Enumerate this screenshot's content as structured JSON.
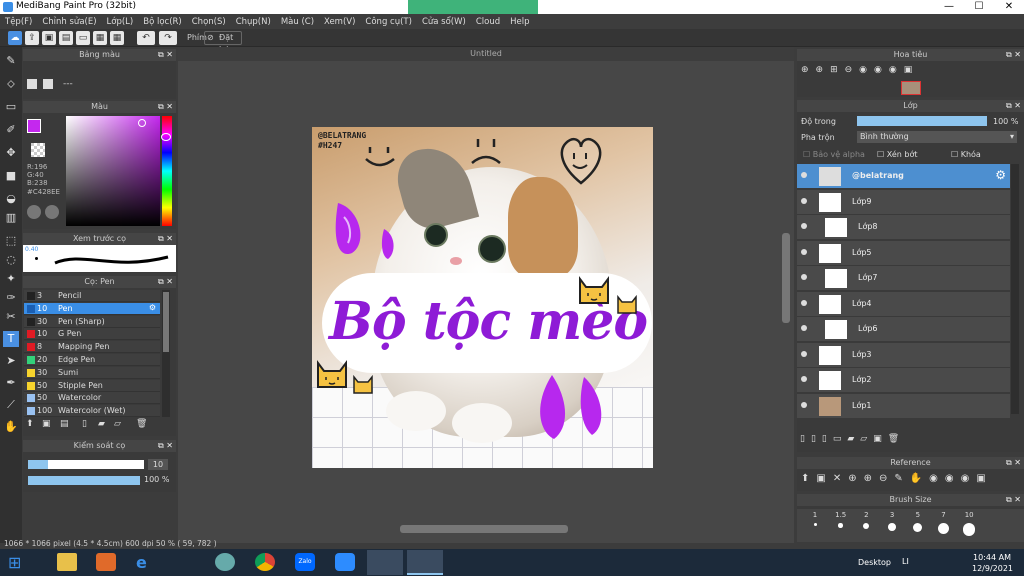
{
  "app": {
    "title": "MediBang Paint Pro (32bit)"
  },
  "menu": [
    "Tệp(F)",
    "Chỉnh sửa(E)",
    "Lớp(L)",
    "Bộ lọc(R)",
    "Chọn(S)",
    "Chụp(N)",
    "Màu (C)",
    "Xem(V)",
    "Công cụ(T)",
    "Cửa sổ(W)",
    "Cloud",
    "Help"
  ],
  "toolbar": {
    "shortcut_label": "Phím",
    "reset_label": "Đặt lại"
  },
  "canvas": {
    "tab_title": "Untitled",
    "status": "1066 * 1066 pixel  (4.5 * 4.5cm)  600 dpi  50 %  ( 59, 782 )"
  },
  "artwork": {
    "watermark": "@BELATRANG\n#H247",
    "title_text": "Bộ tộc mèo"
  },
  "panels": {
    "palette": "Bảng màu",
    "color": "Màu",
    "brush_preview": "Xem trước cọ",
    "brush": "Cọ: Pen",
    "brush_control": "Kiểm soát cọ",
    "navigator": "Hoa tiêu",
    "layer": "Lớp",
    "reference": "Reference",
    "brush_size": "Brush Size"
  },
  "color": {
    "r": "R:196",
    "g": "G:40",
    "b": "B:238",
    "hex": "#C428EE",
    "fg": "#c428ee"
  },
  "palette_text": "---",
  "preview_size": "0.40",
  "brushes": [
    {
      "n": "3",
      "l": "Pencil",
      "c": "#222222"
    },
    {
      "n": "10",
      "l": "Pen",
      "c": "#1a5fb4",
      "sel": true
    },
    {
      "n": "30",
      "l": "Pen (Sharp)",
      "c": "#222222"
    },
    {
      "n": "10",
      "l": "G Pen",
      "c": "#e01b24"
    },
    {
      "n": "8",
      "l": "Mapping Pen",
      "c": "#e01b24"
    },
    {
      "n": "20",
      "l": "Edge Pen",
      "c": "#33d17a"
    },
    {
      "n": "30",
      "l": "Sumi",
      "c": "#f6d32d"
    },
    {
      "n": "50",
      "l": "Stipple Pen",
      "c": "#f6d32d"
    },
    {
      "n": "50",
      "l": "Watercolor",
      "c": "#99c1f1"
    },
    {
      "n": "100",
      "l": "Watercolor (Wet)",
      "c": "#99c1f1"
    }
  ],
  "brush_control": {
    "size": "10",
    "opacity": "100 %"
  },
  "layer_panel": {
    "opacity_label": "Độ trong",
    "opacity_value": "100 %",
    "opacity_fraction": 1.0,
    "blend_label": "Pha trộn",
    "blend_value": "Bình thường",
    "protect_alpha": "Bảo vệ alpha",
    "clipping": "Xén bớt",
    "lock": "Khóa"
  },
  "layers": [
    "@belatrang",
    "Lớp9",
    "Lớp8",
    "Lớp5",
    "Lớp7",
    "Lớp4",
    "Lớp6",
    "Lớp3",
    "Lớp2",
    "Lớp1"
  ],
  "brush_sizes": [
    "1",
    "1.5",
    "2",
    "3",
    "5",
    "7",
    "10"
  ],
  "taskbar": {
    "desktop": "Desktop",
    "lang": "LI",
    "time": "10:44 AM",
    "date": "12/9/2021",
    "zalo": "Zalo"
  }
}
